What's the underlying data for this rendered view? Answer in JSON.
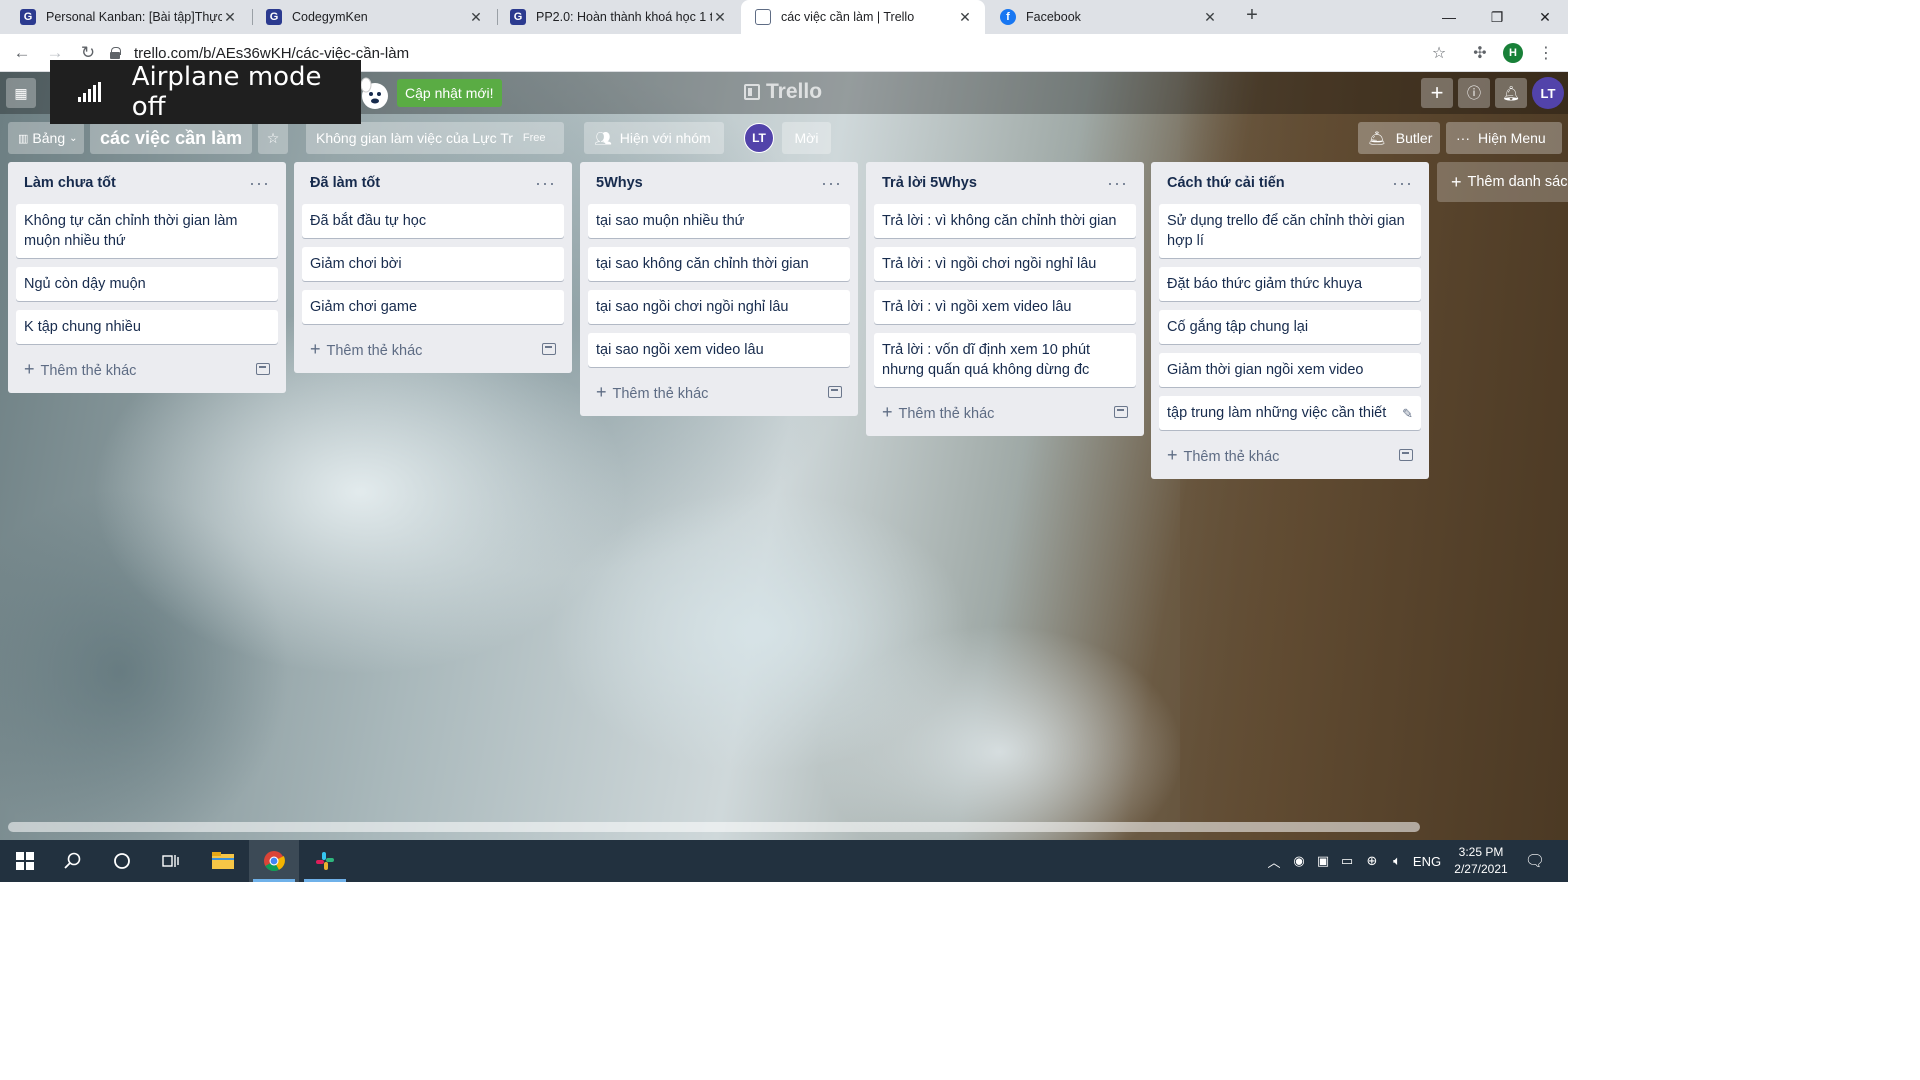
{
  "browser": {
    "tabs": [
      {
        "title": "Personal Kanban: [Bài tập]Thực h",
        "favicon": "codegym-icon"
      },
      {
        "title": "CodegymKen",
        "favicon": "codegym-icon"
      },
      {
        "title": "PP2.0: Hoàn thành khoá học 1 tr",
        "favicon": "codegym-icon"
      },
      {
        "title": "các việc cần làm | Trello",
        "favicon": "trello-icon",
        "active": true
      },
      {
        "title": "Facebook",
        "favicon": "facebook-icon"
      }
    ],
    "url": "trello.com/b/AEs36wKH/các-việc-cần-làm",
    "profile_initial": "H"
  },
  "toast": {
    "message": "Airplane mode off"
  },
  "trello": {
    "logo": "Trello",
    "update_label": "Cập nhật mới!",
    "user_initials": "LT"
  },
  "board": {
    "view_label": "Bảng",
    "title": "các việc cần làm",
    "workspace": "Không gian làm việc của Lực Tr",
    "plan_badge": "Free",
    "visibility_label": "Hiện với nhóm",
    "member_initials": "LT",
    "invite_label": "Mời",
    "butler_label": "Butler",
    "menu_label": "Hiện Menu",
    "add_list_label": "Thêm danh sác"
  },
  "lists": [
    {
      "title": "Làm chưa tốt",
      "cards": [
        "Không tự căn chỉnh thời gian làm muộn nhiều thứ",
        "Ngủ còn dậy muộn",
        "K tập chung nhiều"
      ],
      "add_label": "Thêm thẻ khác"
    },
    {
      "title": "Đã làm tốt",
      "cards": [
        "Đã bắt đầu tự học",
        "Giảm chơi bời",
        "Giảm chơi game"
      ],
      "add_label": "Thêm thẻ khác"
    },
    {
      "title": "5Whys",
      "cards": [
        "tại sao muộn nhiều thứ",
        "tại sao không căn chỉnh thời gian",
        "tại sao ngồi chơi ngồi nghỉ lâu",
        "tại sao ngồi xem video lâu"
      ],
      "add_label": "Thêm thẻ khác"
    },
    {
      "title": "Trả lời 5Whys",
      "cards": [
        "Trả lời : vì không căn chỉnh thời gian",
        "Trả lời : vì ngồi chơi ngồi nghỉ lâu",
        "Trả lời : vì ngồi xem video lâu",
        "Trả lời : vốn dĩ định xem 10 phút nhưng quấn quá không dừng đc"
      ],
      "add_label": "Thêm thẻ khác"
    },
    {
      "title": "Cách thứ cải tiến",
      "cards": [
        "Sử dụng trello để căn chỉnh thời gian hợp lí",
        "Đặt báo thức giảm thức khuya",
        "Cố gắng tập chung lại",
        "Giảm thời gian ngồi xem video",
        "tập trung làm những việc cần thiết"
      ],
      "add_label": "Thêm thẻ khác"
    }
  ],
  "taskbar": {
    "language": "ENG",
    "time": "3:25 PM",
    "date": "2/27/2021"
  },
  "colors": {
    "trello_green": "#5aac44",
    "avatar_purple": "#5243aa",
    "list_bg": "#ebecf0",
    "taskbar_bg": "#22313f"
  }
}
